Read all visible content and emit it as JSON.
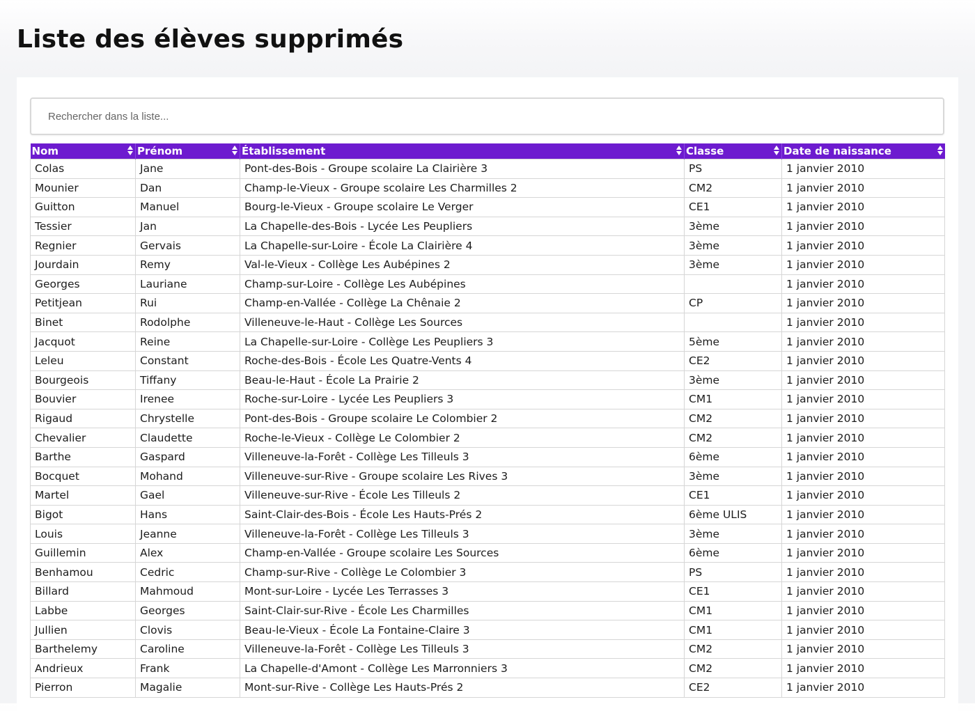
{
  "page": {
    "title": "Liste des élèves supprimés"
  },
  "search": {
    "placeholder": "Rechercher dans la liste..."
  },
  "colors": {
    "header_background": "#6d1bcf",
    "header_text": "#ffffff",
    "row_border": "#d6d6d6"
  },
  "table": {
    "columns": [
      "Nom",
      "Prénom",
      "Établissement",
      "Classe",
      "Date de naissance"
    ],
    "sort_icon": "sort-icon",
    "rows": [
      [
        "Colas",
        "Jane",
        "Pont-des-Bois - Groupe scolaire La Clairière 3",
        "PS",
        "1 janvier 2010"
      ],
      [
        "Mounier",
        "Dan",
        "Champ-le-Vieux - Groupe scolaire Les Charmilles 2",
        "CM2",
        "1 janvier 2010"
      ],
      [
        "Guitton",
        "Manuel",
        "Bourg-le-Vieux - Groupe scolaire Le Verger",
        "CE1",
        "1 janvier 2010"
      ],
      [
        "Tessier",
        "Jan",
        "La Chapelle-des-Bois - Lycée Les Peupliers",
        "3ème",
        "1 janvier 2010"
      ],
      [
        "Regnier",
        "Gervais",
        "La Chapelle-sur-Loire - École La Clairière 4",
        "3ème",
        "1 janvier 2010"
      ],
      [
        "Jourdain",
        "Remy",
        "Val-le-Vieux - Collège Les Aubépines 2",
        "3ème",
        "1 janvier 2010"
      ],
      [
        "Georges",
        "Lauriane",
        "Champ-sur-Loire - Collège Les Aubépines",
        "",
        "1 janvier 2010"
      ],
      [
        "Petitjean",
        "Rui",
        "Champ-en-Vallée - Collège La Chênaie 2",
        "CP",
        "1 janvier 2010"
      ],
      [
        "Binet",
        "Rodolphe",
        "Villeneuve-le-Haut - Collège Les Sources",
        "",
        "1 janvier 2010"
      ],
      [
        "Jacquot",
        "Reine",
        "La Chapelle-sur-Loire - Collège Les Peupliers 3",
        "5ème",
        "1 janvier 2010"
      ],
      [
        "Leleu",
        "Constant",
        "Roche-des-Bois - École Les Quatre-Vents 4",
        "CE2",
        "1 janvier 2010"
      ],
      [
        "Bourgeois",
        "Tiffany",
        "Beau-le-Haut - École La Prairie 2",
        "3ème",
        "1 janvier 2010"
      ],
      [
        "Bouvier",
        "Irenee",
        "Roche-sur-Loire - Lycée Les Peupliers 3",
        "CM1",
        "1 janvier 2010"
      ],
      [
        "Rigaud",
        "Chrystelle",
        "Pont-des-Bois - Groupe scolaire Le Colombier 2",
        "CM2",
        "1 janvier 2010"
      ],
      [
        "Chevalier",
        "Claudette",
        "Roche-le-Vieux - Collège Le Colombier 2",
        "CM2",
        "1 janvier 2010"
      ],
      [
        "Barthe",
        "Gaspard",
        "Villeneuve-la-Forêt - Collège Les Tilleuls 3",
        "6ème",
        "1 janvier 2010"
      ],
      [
        "Bocquet",
        "Mohand",
        "Villeneuve-sur-Rive - Groupe scolaire Les Rives 3",
        "3ème",
        "1 janvier 2010"
      ],
      [
        "Martel",
        "Gael",
        "Villeneuve-sur-Rive - École Les Tilleuls 2",
        "CE1",
        "1 janvier 2010"
      ],
      [
        "Bigot",
        "Hans",
        "Saint-Clair-des-Bois - École Les Hauts-Prés 2",
        "6ème ULIS",
        "1 janvier 2010"
      ],
      [
        "Louis",
        "Jeanne",
        "Villeneuve-la-Forêt - Collège Les Tilleuls 3",
        "3ème",
        "1 janvier 2010"
      ],
      [
        "Guillemin",
        "Alex",
        "Champ-en-Vallée - Groupe scolaire Les Sources",
        "6ème",
        "1 janvier 2010"
      ],
      [
        "Benhamou",
        "Cedric",
        "Champ-sur-Rive - Collège Le Colombier 3",
        "PS",
        "1 janvier 2010"
      ],
      [
        "Billard",
        "Mahmoud",
        "Mont-sur-Loire - Lycée Les Terrasses 3",
        "CE1",
        "1 janvier 2010"
      ],
      [
        "Labbe",
        "Georges",
        "Saint-Clair-sur-Rive - École Les Charmilles",
        "CM1",
        "1 janvier 2010"
      ],
      [
        "Jullien",
        "Clovis",
        "Beau-le-Vieux - École La Fontaine-Claire 3",
        "CM1",
        "1 janvier 2010"
      ],
      [
        "Barthelemy",
        "Caroline",
        "Villeneuve-la-Forêt - Collège Les Tilleuls 3",
        "CM2",
        "1 janvier 2010"
      ],
      [
        "Andrieux",
        "Frank",
        "La Chapelle-d'Amont - Collège Les Marronniers 3",
        "CM2",
        "1 janvier 2010"
      ],
      [
        "Pierron",
        "Magalie",
        "Mont-sur-Rive - Collège Les Hauts-Prés 2",
        "CE2",
        "1 janvier 2010"
      ]
    ]
  }
}
